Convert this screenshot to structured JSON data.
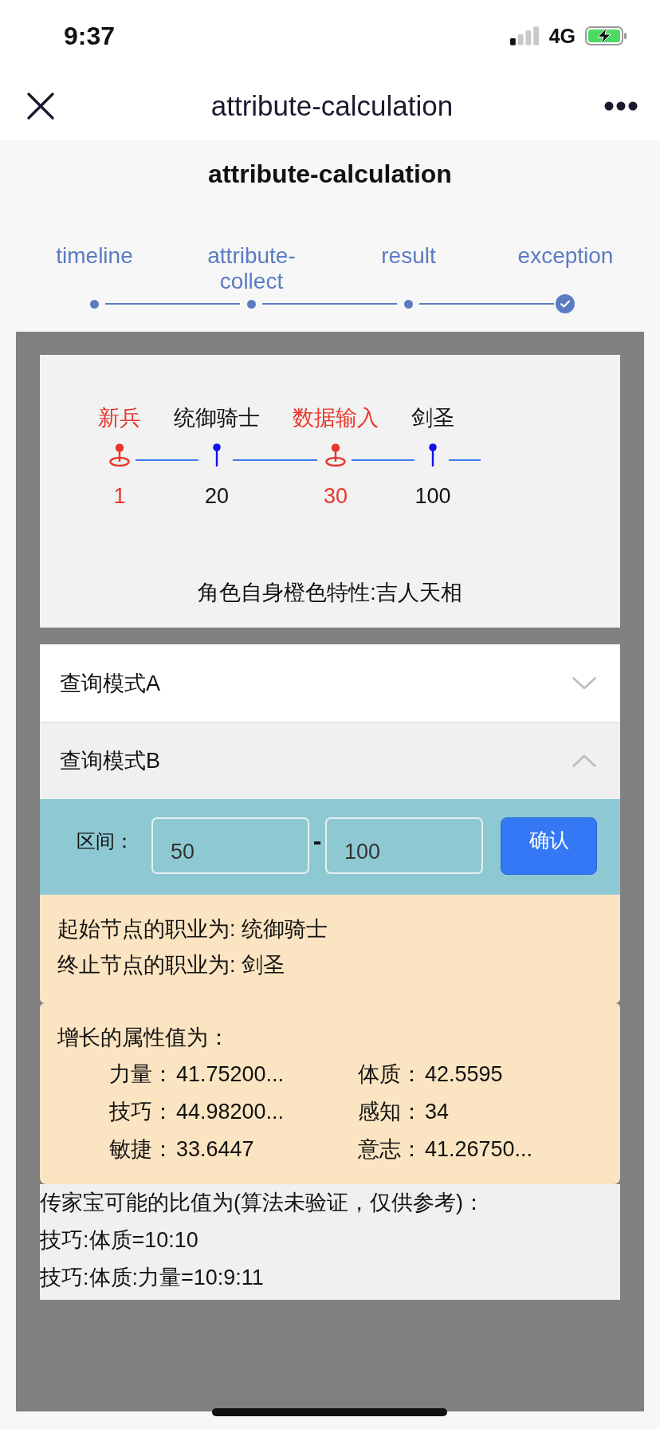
{
  "status_bar": {
    "time": "9:37",
    "network": "4G"
  },
  "nav_bar": {
    "title": "attribute-calculation"
  },
  "page_title": "attribute-calculation",
  "steps": [
    {
      "label": "timeline",
      "selected": false
    },
    {
      "label": "attribute-collect",
      "selected": false
    },
    {
      "label": "result",
      "selected": false
    },
    {
      "label": "exception",
      "selected": true
    }
  ],
  "timeline": {
    "nodes": [
      {
        "name": "新兵",
        "value": "1",
        "highlighted": true
      },
      {
        "name": "统御骑士",
        "value": "20",
        "highlighted": false
      },
      {
        "name": "数据输入",
        "value": "30",
        "highlighted": true
      },
      {
        "name": "剑圣",
        "value": "100",
        "highlighted": false
      }
    ],
    "trait": "角色自身橙色特性:吉人天相"
  },
  "accordion": [
    {
      "title": "查询模式A",
      "expanded": false
    },
    {
      "title": "查询模式B",
      "expanded": true,
      "range": {
        "label": "区间：",
        "start": "50",
        "separator": "-",
        "end": "100",
        "button": "确认"
      },
      "summary": [
        "起始节点的职业为: 统御骑士",
        "终止节点的职业为: 剑圣"
      ],
      "growth": {
        "title": "增长的属性值为：",
        "stats": [
          {
            "name": "力量：",
            "value": "41.75200..."
          },
          {
            "name": "体质：",
            "value": "42.5595"
          },
          {
            "name": "技巧：",
            "value": "44.98200..."
          },
          {
            "name": "感知：",
            "value": "34"
          },
          {
            "name": "敏捷：",
            "value": "33.6447"
          },
          {
            "name": "意志：",
            "value": "41.26750..."
          }
        ]
      },
      "heirloom": {
        "title": "传家宝可能的比值为(算法未验证，仅供参考)：",
        "ratios": [
          "技巧:体质=10:10",
          "技巧:体质:力量=10:9:11"
        ]
      }
    }
  ]
}
